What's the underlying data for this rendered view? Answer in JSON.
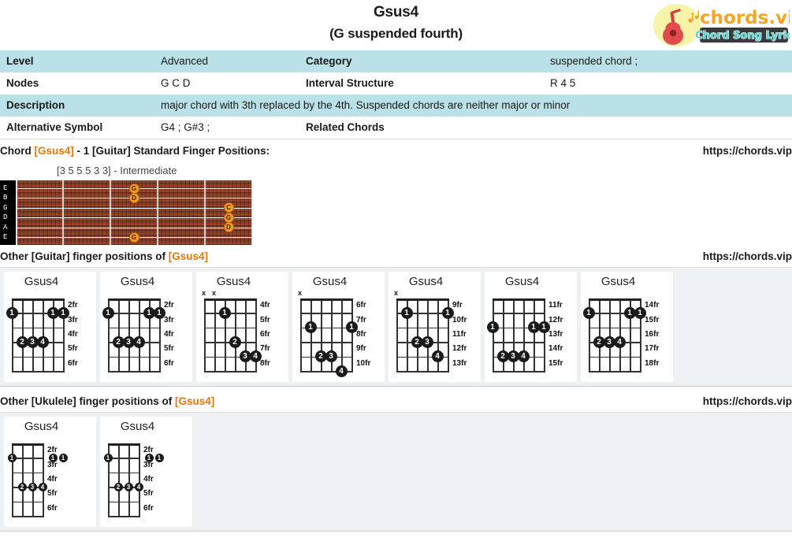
{
  "header": {
    "title": "Gsus4",
    "subtitle": "(G suspended fourth)",
    "logo_name": "chords.vip",
    "logo_tagline": "Chord Song Lyric"
  },
  "info_table": {
    "rows": [
      {
        "label_left": "Level",
        "value_left": "Advanced",
        "label_right": "Category",
        "value_right": "suspended chord ;",
        "shaded": true
      },
      {
        "label_left": "Nodes",
        "value_left": "G C D",
        "label_right": "Interval Structure",
        "value_right": "R 4 5",
        "shaded": false
      },
      {
        "label_left": "Description",
        "value_left": "major chord with 3th replaced by the 4th. Suspended chords are neither major or minor",
        "label_right": "",
        "value_right": "",
        "shaded": true
      },
      {
        "label_left": "Alternative Symbol",
        "value_left": " G4 ; G#3 ;",
        "label_right": "Related Chords",
        "value_right": "",
        "shaded": false
      }
    ]
  },
  "sections": {
    "standard": {
      "prefix": "Chord ",
      "accent": "[Gsus4]",
      "suffix": " - 1 [Guitar] Standard Finger Positions:",
      "url": "https://chords.vip",
      "caption": "[3 5 5 5 3 3] - Intermediate"
    },
    "guitar_other": {
      "prefix": "Other [Guitar] finger positions of ",
      "accent": "[Gsus4]",
      "suffix": "",
      "url": "https://chords.vip"
    },
    "ukulele_other": {
      "prefix": "Other [Ukulele] finger positions of ",
      "accent": "[Gsus4]",
      "suffix": "",
      "url": "https://chords.vip"
    }
  },
  "fretboard": {
    "string_labels": [
      "E",
      "B",
      "G",
      "D",
      "A",
      "E"
    ],
    "notes": [
      {
        "string": 0,
        "fret": 3,
        "label": "G"
      },
      {
        "string": 1,
        "fret": 3,
        "label": "D"
      },
      {
        "string": 2,
        "fret": 5,
        "label": "C"
      },
      {
        "string": 3,
        "fret": 5,
        "label": "G"
      },
      {
        "string": 4,
        "fret": 5,
        "label": "D"
      },
      {
        "string": 5,
        "fret": 3,
        "label": "G"
      }
    ],
    "num_frets": 5,
    "note_color": "#f79b28"
  },
  "guitar_diagrams": [
    {
      "title": "Gsus4",
      "fret_labels": [
        "2fr",
        "3fr",
        "4fr",
        "5fr",
        "6fr"
      ],
      "mutes": [],
      "dots": [
        {
          "string": 1,
          "fret_row": 2,
          "finger": "1"
        },
        {
          "string": 5,
          "fret_row": 2,
          "finger": "1"
        },
        {
          "string": 6,
          "fret_row": 2,
          "finger": "1"
        },
        {
          "string": 2,
          "fret_row": 4,
          "finger": "2"
        },
        {
          "string": 3,
          "fret_row": 4,
          "finger": "3"
        },
        {
          "string": 4,
          "fret_row": 4,
          "finger": "4"
        }
      ]
    },
    {
      "title": "Gsus4",
      "fret_labels": [
        "2fr",
        "3fr",
        "4fr",
        "5fr",
        "6fr"
      ],
      "mutes": [],
      "dots": [
        {
          "string": 1,
          "fret_row": 2,
          "finger": "1"
        },
        {
          "string": 5,
          "fret_row": 2,
          "finger": "1"
        },
        {
          "string": 6,
          "fret_row": 2,
          "finger": "1"
        },
        {
          "string": 2,
          "fret_row": 4,
          "finger": "2"
        },
        {
          "string": 3,
          "fret_row": 4,
          "finger": "3"
        },
        {
          "string": 4,
          "fret_row": 4,
          "finger": "4"
        }
      ]
    },
    {
      "title": "Gsus4",
      "fret_labels": [
        "4fr",
        "5fr",
        "6fr",
        "7fr",
        "8fr"
      ],
      "mutes": [
        1,
        2
      ],
      "dots": [
        {
          "string": 3,
          "fret_row": 2,
          "finger": "1"
        },
        {
          "string": 4,
          "fret_row": 4,
          "finger": "2"
        },
        {
          "string": 5,
          "fret_row": 5,
          "finger": "3"
        },
        {
          "string": 6,
          "fret_row": 5,
          "finger": "4"
        }
      ]
    },
    {
      "title": "Gsus4",
      "fret_labels": [
        "6fr",
        "7fr",
        "8fr",
        "9fr",
        "10fr"
      ],
      "mutes": [
        1
      ],
      "dots": [
        {
          "string": 2,
          "fret_row": 3,
          "finger": "1"
        },
        {
          "string": 6,
          "fret_row": 3,
          "finger": "1"
        },
        {
          "string": 3,
          "fret_row": 5,
          "finger": "2"
        },
        {
          "string": 4,
          "fret_row": 5,
          "finger": "3"
        },
        {
          "string": 5,
          "fret_row": 6,
          "finger": "4"
        }
      ]
    },
    {
      "title": "Gsus4",
      "fret_labels": [
        "9fr",
        "10fr",
        "11fr",
        "12fr",
        "13fr"
      ],
      "mutes": [
        1
      ],
      "dots": [
        {
          "string": 2,
          "fret_row": 2,
          "finger": "1"
        },
        {
          "string": 6,
          "fret_row": 2,
          "finger": "1"
        },
        {
          "string": 3,
          "fret_row": 4,
          "finger": "2"
        },
        {
          "string": 4,
          "fret_row": 4,
          "finger": "3"
        },
        {
          "string": 5,
          "fret_row": 5,
          "finger": "4"
        }
      ]
    },
    {
      "title": "Gsus4",
      "fret_labels": [
        "11fr",
        "12fr",
        "13fr",
        "14fr",
        "15fr"
      ],
      "mutes": [],
      "dots": [
        {
          "string": 1,
          "fret_row": 3,
          "finger": "1"
        },
        {
          "string": 5,
          "fret_row": 3,
          "finger": "1"
        },
        {
          "string": 6,
          "fret_row": 3,
          "finger": "1"
        },
        {
          "string": 2,
          "fret_row": 5,
          "finger": "2"
        },
        {
          "string": 3,
          "fret_row": 5,
          "finger": "3"
        },
        {
          "string": 4,
          "fret_row": 5,
          "finger": "4"
        }
      ]
    },
    {
      "title": "Gsus4",
      "fret_labels": [
        "14fr",
        "15fr",
        "16fr",
        "17fr",
        "18fr"
      ],
      "mutes": [],
      "dots": [
        {
          "string": 1,
          "fret_row": 2,
          "finger": "1"
        },
        {
          "string": 5,
          "fret_row": 2,
          "finger": "1"
        },
        {
          "string": 6,
          "fret_row": 2,
          "finger": "1"
        },
        {
          "string": 2,
          "fret_row": 4,
          "finger": "2"
        },
        {
          "string": 3,
          "fret_row": 4,
          "finger": "3"
        },
        {
          "string": 4,
          "fret_row": 4,
          "finger": "4"
        }
      ]
    }
  ],
  "ukulele_diagrams": [
    {
      "title": "Gsus4",
      "fret_labels": [
        "2fr",
        "3fr",
        "4fr",
        "5fr",
        "6fr"
      ],
      "dots": [
        {
          "string": 1,
          "fret_row": 2,
          "finger": "1"
        },
        {
          "string": 5,
          "fret_row": 2,
          "finger": "1"
        },
        {
          "string": 6,
          "fret_row": 2,
          "finger": "1"
        },
        {
          "string": 2,
          "fret_row": 4,
          "finger": "2"
        },
        {
          "string": 3,
          "fret_row": 4,
          "finger": "3"
        },
        {
          "string": 4,
          "fret_row": 4,
          "finger": "4"
        }
      ]
    },
    {
      "title": "Gsus4",
      "fret_labels": [
        "2fr",
        "3fr",
        "4fr",
        "5fr",
        "6fr"
      ],
      "dots": [
        {
          "string": 1,
          "fret_row": 2,
          "finger": "1"
        },
        {
          "string": 5,
          "fret_row": 2,
          "finger": "1"
        },
        {
          "string": 6,
          "fret_row": 2,
          "finger": "1"
        },
        {
          "string": 2,
          "fret_row": 4,
          "finger": "2"
        },
        {
          "string": 3,
          "fret_row": 4,
          "finger": "3"
        },
        {
          "string": 4,
          "fret_row": 4,
          "finger": "4"
        }
      ]
    }
  ],
  "colors": {
    "table_shaded": "#b9e1e7",
    "accent_orange": "#e8770a",
    "strip_bg": "#eef1f4",
    "fretboard_wood": "#8a3a22"
  }
}
